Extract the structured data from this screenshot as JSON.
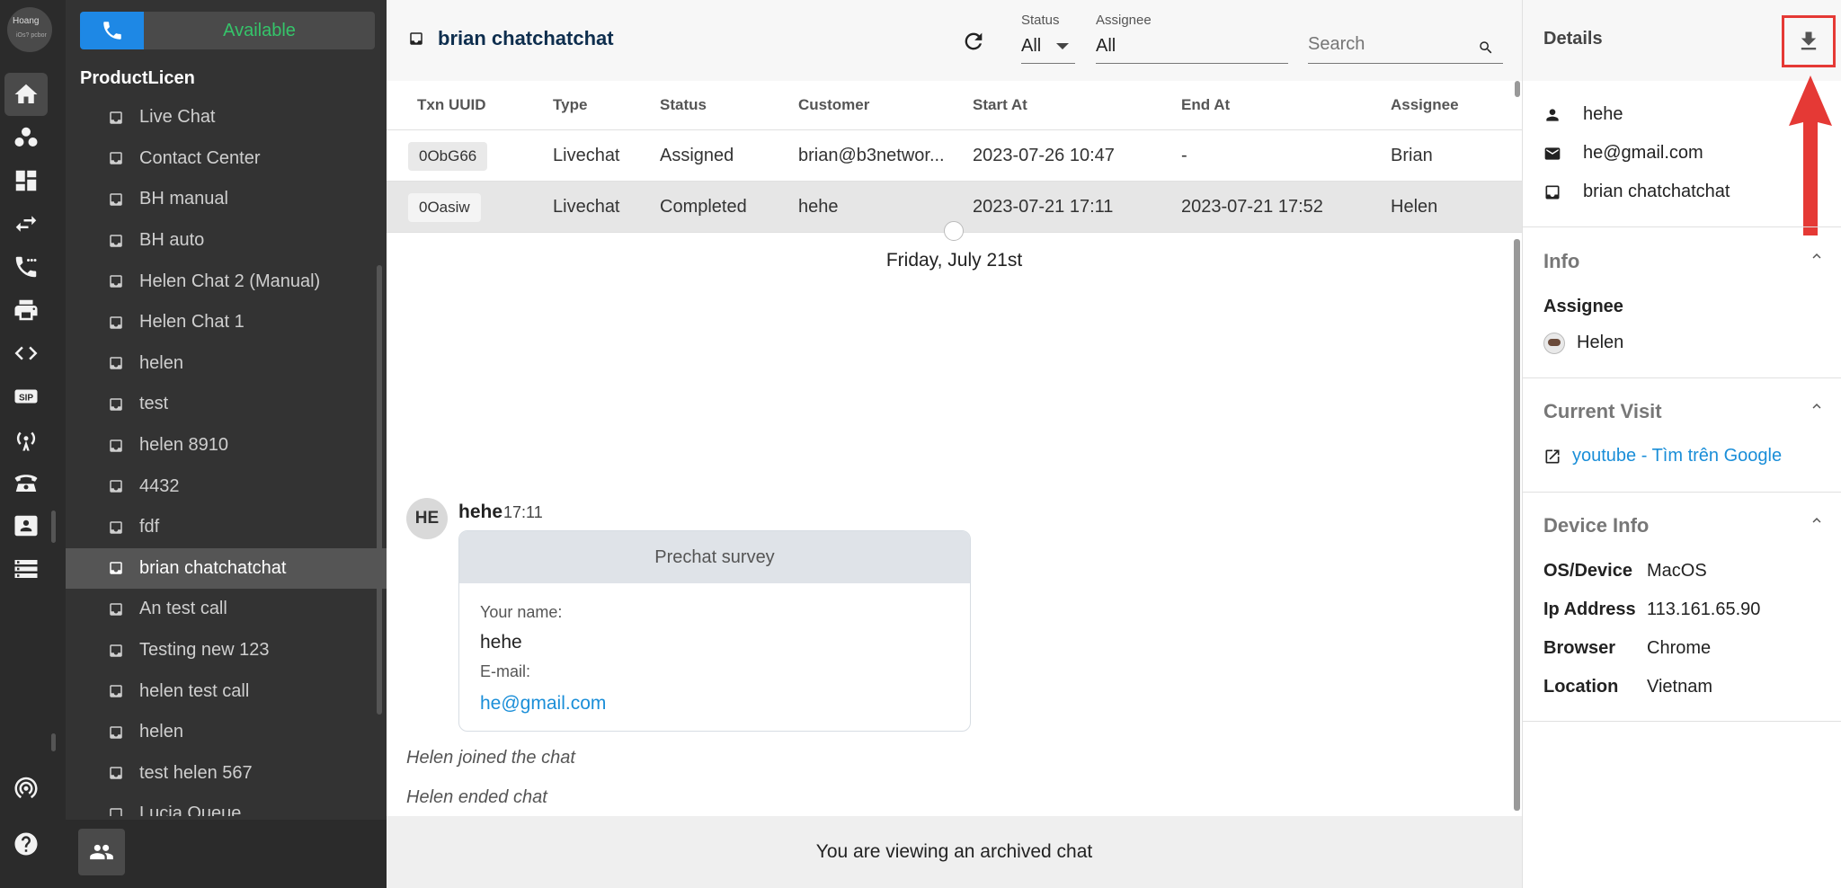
{
  "user": {
    "name": "Hoang",
    "ext": "7:0",
    "sub": "iOs? pcbor"
  },
  "agent_status": "Available",
  "org_name": "ProductLicen",
  "channels": [
    {
      "label": "Live Chat",
      "selected": false
    },
    {
      "label": "Contact Center",
      "selected": false
    },
    {
      "label": "BH manual",
      "selected": false
    },
    {
      "label": "BH auto",
      "selected": false
    },
    {
      "label": "Helen Chat 2 (Manual)",
      "selected": false
    },
    {
      "label": "Helen Chat 1",
      "selected": false
    },
    {
      "label": "helen",
      "selected": false
    },
    {
      "label": "test",
      "selected": false
    },
    {
      "label": "helen 8910",
      "selected": false
    },
    {
      "label": "4432",
      "selected": false
    },
    {
      "label": "fdf",
      "selected": false
    },
    {
      "label": "brian chatchatchat",
      "selected": true
    },
    {
      "label": "An test call",
      "selected": false
    },
    {
      "label": "Testing new 123",
      "selected": false
    },
    {
      "label": "helen test call",
      "selected": false
    },
    {
      "label": "helen",
      "selected": false
    },
    {
      "label": "test helen 567",
      "selected": false
    },
    {
      "label": "Lucia Queue",
      "selected": false
    }
  ],
  "header": {
    "title": "brian chatchatchat",
    "status_label": "Status",
    "status_value": "All",
    "assignee_label": "Assignee",
    "assignee_value": "All",
    "search_placeholder": "Search"
  },
  "table": {
    "columns": [
      "Txn UUID",
      "Type",
      "Status",
      "Customer",
      "Start At",
      "End At",
      "Assignee"
    ],
    "rows": [
      {
        "uuid": "0ObG66",
        "type": "Livechat",
        "status": "Assigned",
        "customer": "brian@b3networ...",
        "start": "2023-07-26 10:47",
        "end": "-",
        "assignee": "Brian",
        "selected": false
      },
      {
        "uuid": "0Oasiw",
        "type": "Livechat",
        "status": "Completed",
        "customer": "hehe",
        "start": "2023-07-21 17:11",
        "end": "2023-07-21 17:52",
        "assignee": "Helen",
        "selected": true
      }
    ]
  },
  "conversation": {
    "day": "Friday, July 21st",
    "avatar_initials": "HE",
    "sender": "hehe",
    "time": "17:11",
    "prechat": {
      "title": "Prechat survey",
      "name_label": "Your name:",
      "name_value": "hehe",
      "email_label": "E-mail:",
      "email_value": "he@gmail.com"
    },
    "system_messages": [
      "Helen joined the chat",
      "Helen ended chat"
    ],
    "archived_notice": "You are viewing an archived chat"
  },
  "details": {
    "title": "Details",
    "contact": {
      "name": "hehe",
      "email": "he@gmail.com",
      "channel": "brian chatchatchat"
    },
    "info": {
      "title": "Info",
      "assignee_label": "Assignee",
      "assignee_name": "Helen"
    },
    "current_visit": {
      "title": "Current Visit",
      "link_text": "youtube - Tìm trên Google"
    },
    "device_info": {
      "title": "Device Info",
      "rows": [
        {
          "key": "OS/Device",
          "value": "MacOS"
        },
        {
          "key": "Ip Address",
          "value": "113.161.65.90"
        },
        {
          "key": "Browser",
          "value": "Chrome"
        },
        {
          "key": "Location",
          "value": "Vietnam"
        }
      ]
    }
  },
  "colors": {
    "accent": "#1e88e5",
    "available": "#35c46a",
    "link": "#1a8ed8",
    "annotation": "#e53935"
  }
}
